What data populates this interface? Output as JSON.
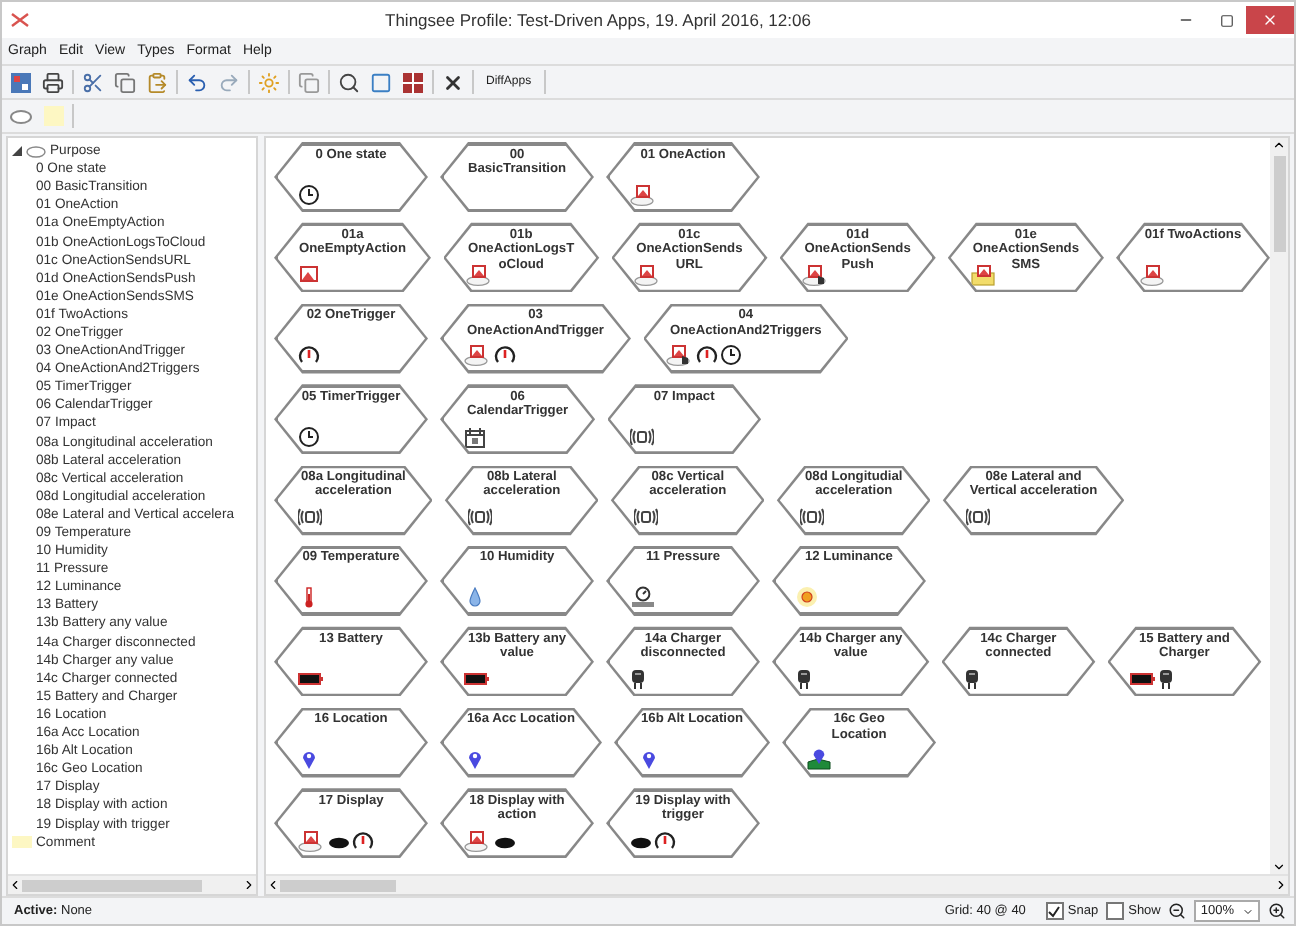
{
  "window": {
    "title": "Thingsee Profile: Test-Driven Apps, 19. April 2016, 12:06"
  },
  "menu": [
    "Graph",
    "Edit",
    "View",
    "Types",
    "Format",
    "Help"
  ],
  "toolbar": {
    "button": "DiffApps"
  },
  "sidebar": {
    "tree": [
      {
        "label": "Purpose",
        "kind": "state",
        "expanded": true,
        "children": [
          {
            "label": "0 One state"
          },
          {
            "label": "00 BasicTransition"
          },
          {
            "label": "01 OneAction"
          },
          {
            "label": "01a OneEmptyAction"
          },
          {
            "label": "01b OneActionLogsToCloud"
          },
          {
            "label": "01c OneActionSendsURL"
          },
          {
            "label": "01d OneActionSendsPush"
          },
          {
            "label": "01e OneActionSendsSMS"
          },
          {
            "label": "01f TwoActions"
          },
          {
            "label": "02 OneTrigger"
          },
          {
            "label": "03 OneActionAndTrigger"
          },
          {
            "label": "04 OneActionAnd2Triggers"
          },
          {
            "label": "05 TimerTrigger"
          },
          {
            "label": "06 CalendarTrigger"
          },
          {
            "label": "07 Impact"
          },
          {
            "label": "08a Longitudinal acceleration"
          },
          {
            "label": "08b Lateral acceleration"
          },
          {
            "label": "08c Vertical acceleration"
          },
          {
            "label": "08d Longitudial acceleration"
          },
          {
            "label": "08e Lateral and Vertical accelera"
          },
          {
            "label": "09 Temperature"
          },
          {
            "label": "10 Humidity"
          },
          {
            "label": "11 Pressure"
          },
          {
            "label": "12 Luminance"
          },
          {
            "label": "13 Battery"
          },
          {
            "label": "13b Battery any value"
          },
          {
            "label": "14a Charger disconnected"
          },
          {
            "label": "14b Charger any value"
          },
          {
            "label": "14c Charger connected"
          },
          {
            "label": "15 Battery and Charger"
          },
          {
            "label": "16 Location"
          },
          {
            "label": "16a Acc Location"
          },
          {
            "label": "16b Alt Location"
          },
          {
            "label": "16c Geo Location"
          },
          {
            "label": "17 Display"
          },
          {
            "label": "18 Display with action"
          },
          {
            "label": "19 Display with trigger"
          }
        ]
      },
      {
        "label": "Comment",
        "kind": "comment"
      }
    ]
  },
  "canvas": {
    "rows": [
      {
        "nodes": [
          {
            "title": "0 One state",
            "icons": [
              {
                "kind": "clock"
              }
            ]
          },
          {
            "title": "00\nBasicTransition"
          },
          {
            "title": "01 OneAction",
            "icons": [
              {
                "kind": "image-cloud"
              }
            ]
          }
        ]
      },
      {
        "nodes": [
          {
            "title": "01a\nOneEmptyAction",
            "icons": [
              {
                "kind": "image"
              }
            ]
          },
          {
            "title": "01b\nOneActionLogsT\noCloud",
            "icons": [
              {
                "kind": "image-cloud"
              }
            ]
          },
          {
            "title": "01c\nOneActionSends\nURL",
            "icons": [
              {
                "kind": "image-cloud"
              }
            ]
          },
          {
            "title": "01d\nOneActionSends\nPush",
            "icons": [
              {
                "kind": "image-pointer"
              }
            ]
          },
          {
            "title": "01e\nOneActionSends\nSMS",
            "icons": [
              {
                "kind": "image-envelope"
              }
            ]
          },
          {
            "title": "01f TwoActions",
            "icons": [
              {
                "kind": "image-cloud"
              }
            ]
          }
        ]
      },
      {
        "nodes": [
          {
            "title": "02 OneTrigger",
            "icons": [
              {
                "kind": "gauge"
              }
            ]
          },
          {
            "title": "03\nOneActionAndTrigger",
            "icons": [
              {
                "kind": "image-cloud"
              },
              {
                "kind": "gauge"
              }
            ]
          },
          {
            "title": "04\nOneActionAnd2Triggers",
            "icons": [
              {
                "kind": "image-pointer"
              },
              {
                "kind": "gauge"
              },
              {
                "kind": "clock"
              }
            ]
          }
        ]
      },
      {
        "nodes": [
          {
            "title": "05 TimerTrigger",
            "icons": [
              {
                "kind": "clock"
              }
            ]
          },
          {
            "title": "06\nCalendarTrigger",
            "icons": [
              {
                "kind": "calendar"
              }
            ]
          },
          {
            "title": "07 Impact",
            "icons": [
              {
                "kind": "vibration"
              }
            ]
          }
        ]
      },
      {
        "nodes": [
          {
            "title": "08a Longitudinal\nacceleration",
            "icons": [
              {
                "kind": "vibration"
              }
            ]
          },
          {
            "title": "08b Lateral\nacceleration",
            "icons": [
              {
                "kind": "vibration"
              }
            ]
          },
          {
            "title": "08c Vertical\nacceleration",
            "icons": [
              {
                "kind": "vibration"
              }
            ]
          },
          {
            "title": "08d Longitudial\nacceleration",
            "icons": [
              {
                "kind": "vibration"
              }
            ]
          },
          {
            "title": "08e Lateral and\nVertical acceleration",
            "icons": [
              {
                "kind": "vibration"
              }
            ]
          }
        ]
      },
      {
        "nodes": [
          {
            "title": "09 Temperature",
            "icons": [
              {
                "kind": "thermometer"
              }
            ]
          },
          {
            "title": "10 Humidity",
            "icons": [
              {
                "kind": "drop"
              }
            ]
          },
          {
            "title": "11 Pressure",
            "icons": [
              {
                "kind": "pressure"
              }
            ]
          },
          {
            "title": "12 Luminance",
            "icons": [
              {
                "kind": "sun"
              }
            ]
          }
        ]
      },
      {
        "nodes": [
          {
            "title": "13 Battery",
            "icons": [
              {
                "kind": "battery"
              }
            ]
          },
          {
            "title": "13b Battery any\nvalue",
            "icons": [
              {
                "kind": "battery"
              }
            ]
          },
          {
            "title": "14a Charger\ndisconnected",
            "icons": [
              {
                "kind": "plug"
              }
            ]
          },
          {
            "title": "14b Charger any\nvalue",
            "icons": [
              {
                "kind": "plug"
              }
            ]
          },
          {
            "title": "14c Charger\nconnected",
            "icons": [
              {
                "kind": "plug"
              }
            ]
          },
          {
            "title": "15 Battery and\nCharger",
            "icons": [
              {
                "kind": "battery"
              },
              {
                "kind": "plug"
              }
            ]
          }
        ]
      },
      {
        "nodes": [
          {
            "title": "16 Location",
            "icons": [
              {
                "kind": "pin"
              }
            ]
          },
          {
            "title": "16a Acc Location",
            "icons": [
              {
                "kind": "pin"
              }
            ]
          },
          {
            "title": "16b Alt Location",
            "icons": [
              {
                "kind": "pin"
              }
            ]
          },
          {
            "title": "16c Geo\nLocation",
            "icons": [
              {
                "kind": "pin-map"
              }
            ]
          }
        ]
      },
      {
        "nodes": [
          {
            "title": "17 Display",
            "icons": [
              {
                "kind": "image-cloud"
              },
              {
                "kind": "display"
              },
              {
                "kind": "gauge"
              }
            ]
          },
          {
            "title": "18 Display with\naction",
            "icons": [
              {
                "kind": "image-cloud"
              },
              {
                "kind": "display"
              }
            ]
          },
          {
            "title": "19 Display with\ntrigger",
            "icons": [
              {
                "kind": "display"
              },
              {
                "kind": "gauge"
              }
            ]
          }
        ]
      }
    ]
  },
  "status_bar": {
    "active": "**Active:** None",
    "grid": "Grid: 40 @ 40",
    "snap": {
      "label": "Snap",
      "checked": true
    },
    "show": {
      "label": "Show",
      "checked": false
    },
    "zoom": "100%"
  }
}
